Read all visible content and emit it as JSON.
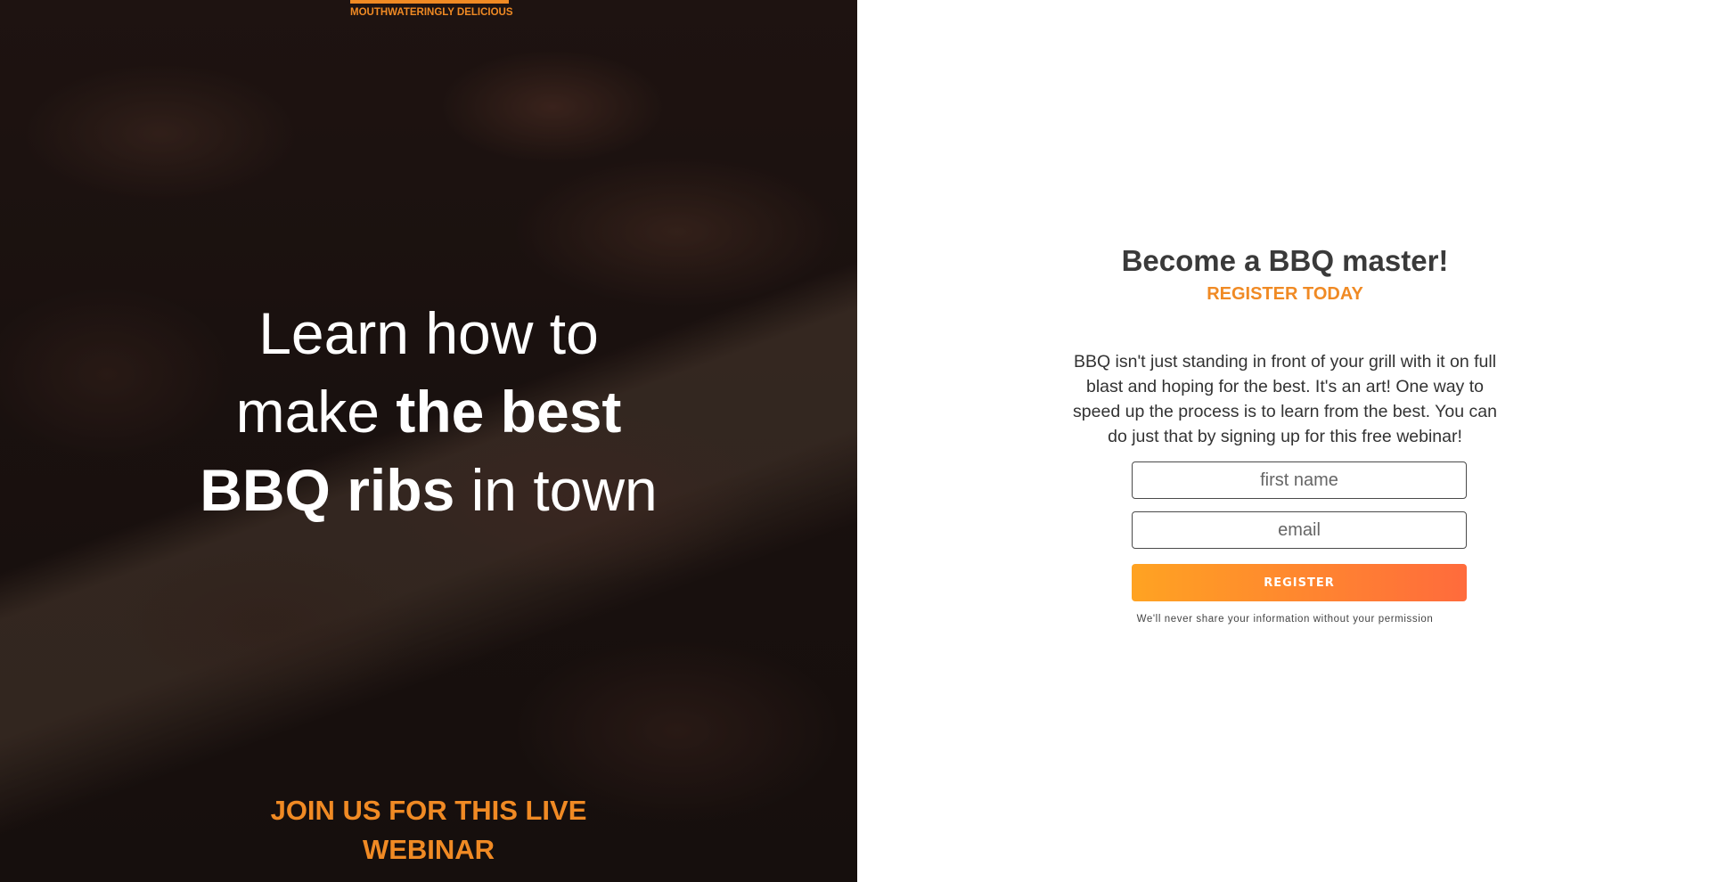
{
  "hero": {
    "tagline": "MOUTHWATERINGLY DELICIOUS",
    "headline": {
      "line1": "Learn how to",
      "line2_light": "make ",
      "line2_bold": "the best",
      "line3_bold": "BBQ ribs",
      "line3_light": " in town"
    },
    "join_line1": "JOIN US FOR THIS LIVE",
    "join_line2": "WEBINAR"
  },
  "form": {
    "title": "Become a BBQ master!",
    "subtitle": "REGISTER TODAY",
    "description": "BBQ isn't just standing in front of your grill with it on full blast and hoping for the best. It's an art! One way to speed up the process is to learn from the best. You can do just that by signing up for this free webinar!",
    "first_name_placeholder": "first name",
    "email_placeholder": "email",
    "register_label": "REGISTER",
    "privacy_note": "We'll never share your information without your permission"
  },
  "colors": {
    "accent": "#f08a24",
    "button_start": "#ffa322",
    "button_end": "#ff6b3c",
    "heading": "#3a3a3a"
  }
}
